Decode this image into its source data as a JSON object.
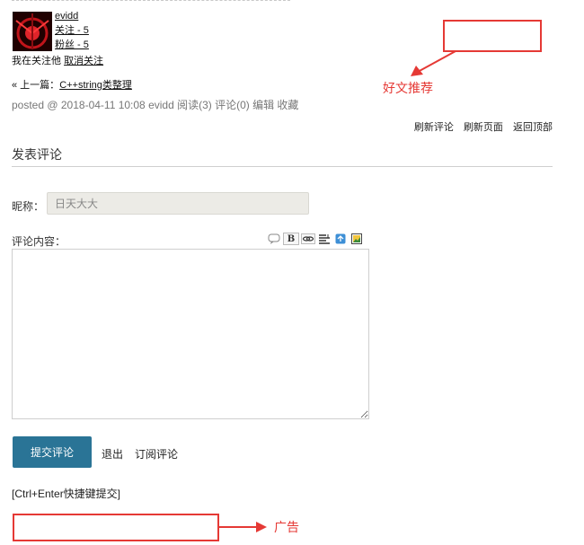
{
  "author": {
    "name": "evidd",
    "following": "关注 - 5",
    "followers": "粉丝 - 5",
    "follow_status": "我在关注他",
    "unfollow_label": "取消关注"
  },
  "prev_post": {
    "prefix": "« 上一篇：",
    "title": "C++string类整理"
  },
  "post_info": "posted @ 2018-04-11 10:08 evidd 阅读(3) 评论(0) 编辑 收藏",
  "footer_links": [
    "刷新评论",
    "刷新页面",
    "返回顶部"
  ],
  "comment_form": {
    "section_title": "发表评论",
    "nick_label": "昵称：",
    "nick_value": "日天大大",
    "content_label": "评论内容：",
    "toolbar_icons": [
      "quote-icon",
      "bold-icon",
      "link-icon",
      "code-icon",
      "upload-icon",
      "image-icon"
    ],
    "submit_label": "提交评论",
    "logout_label": "退出",
    "subscribe_label": "订阅评论",
    "shortcut_hint": "[Ctrl+Enter快捷键提交]"
  },
  "annotations": {
    "recommend_label": "好文推荐",
    "ad_label": "广告",
    "color": "#e53935"
  }
}
